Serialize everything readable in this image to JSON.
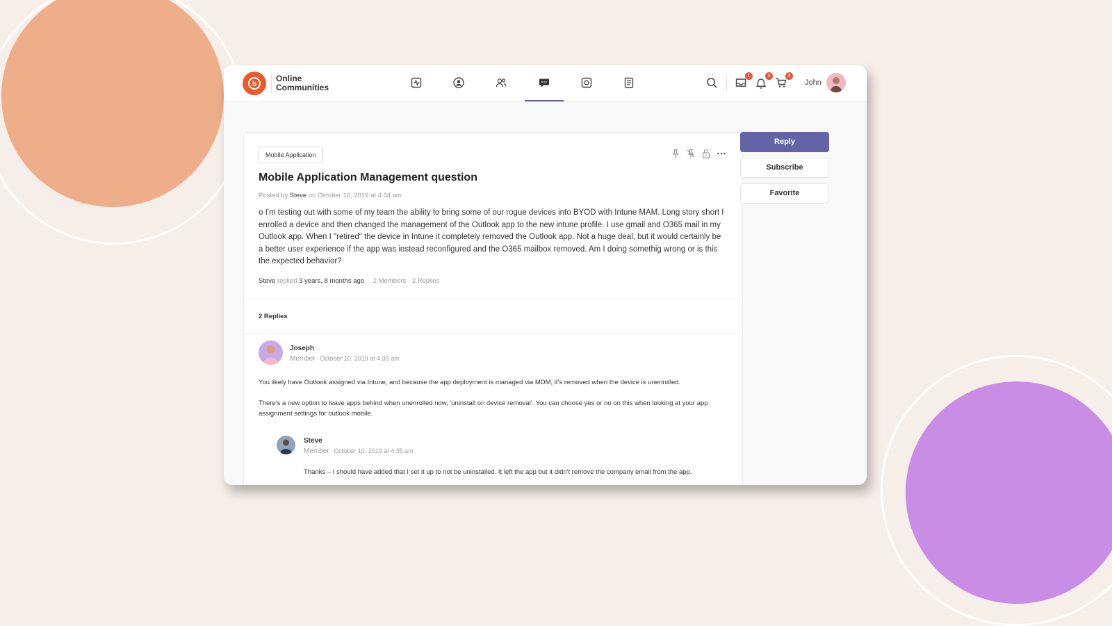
{
  "brand": {
    "line1": "Online",
    "line2": "Communities"
  },
  "nav": [
    {
      "icon": "activity-icon"
    },
    {
      "icon": "profile-icon"
    },
    {
      "icon": "members-icon"
    },
    {
      "icon": "discussions-icon",
      "active": true
    },
    {
      "icon": "photos-icon"
    },
    {
      "icon": "documents-icon"
    }
  ],
  "header": {
    "user_name": "John",
    "badges": {
      "messages": "1",
      "notifications": "3",
      "cart": "3"
    }
  },
  "post": {
    "tag": "Mobile Application",
    "title": "Mobile Application Management question",
    "posted_by_prefix": "Posted by",
    "author": "Steve",
    "date": "on October 10, 2019 at 4:34 am",
    "body": "o I'm testing out with some of my team the ability to bring some of our rogue devices into BYOD with Intune MAM. Long story short I enrolled a device and then changed the management of the Outlook app to the new intune profile. I use gmail and O365 mail in my Outlook app. When I \"retired\" the device in Intune it completely removed the Outlook app. Not a huge deal, but it would certainly be a better user experience if the app was instead reconfigured and the O365 mailbox removed. Am I doing somethig wrong or is this the expected behavior?",
    "activity": {
      "user": "Steve",
      "verb": "replied",
      "time": "3 years, 8 months ago",
      "stats": "2 Members · 2 Replies"
    }
  },
  "replies": {
    "count_label": "2 Replies",
    "items": [
      {
        "name": "Joseph",
        "role": "Member",
        "date": "October 10, 2019 at 4:35 am",
        "paragraph1": "You likely have Outlook assigned via Intune, and because the app deployment is managed via MDM, it's removed when the device is unenrolled.",
        "paragraph2": "There's a new option to leave apps behind when unenrolled now, 'uninstall on device removal'. You can choose yes or no on this when looking at your app assignment settings for outlook mobile."
      },
      {
        "name": "Steve",
        "role": "Member",
        "date": "October 10, 2019 at 4:35 am",
        "paragraph1": "Thanks – I should have added that I set it up to not be uninstalled. It left the app but it didn't remove the company email from the app."
      }
    ]
  },
  "sidebar_actions": {
    "reply": "Reply",
    "subscribe": "Subscribe",
    "favorite": "Favorite"
  },
  "colors": {
    "accent": "#6264a7",
    "logo": "#e65a2e",
    "badge": "#e8563a",
    "background": "#f6eee8",
    "circle_orange": "#efae8a",
    "circle_purple": "#c98de5"
  }
}
